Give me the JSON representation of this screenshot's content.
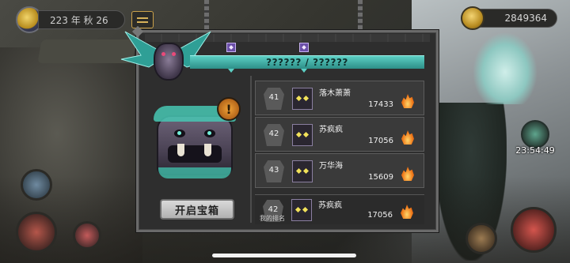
{
  "hud": {
    "date_text": "223 年 秋 26",
    "gold_amount": "2849364",
    "timer": "23:54:49"
  },
  "dialog": {
    "title": "?????? / ??????",
    "open_chest_label": "开启宝箱",
    "alert_glyph": "!",
    "my_rank_label": "我的排名"
  },
  "ranking": {
    "rows": [
      {
        "rank": "41",
        "name": "落木萧萧",
        "score": "17433"
      },
      {
        "rank": "42",
        "name": "苏疯疯",
        "score": "17056"
      },
      {
        "rank": "43",
        "name": "万华海",
        "score": "15609"
      }
    ],
    "my_row": {
      "rank": "42",
      "name": "苏疯疯",
      "score": "17056"
    }
  },
  "icons": {
    "season": "moon-icon",
    "currency": "gold-coin-icon",
    "menu": "menu-icon",
    "score": "fire-icon"
  },
  "colors": {
    "accent_teal": "#5ccfc4",
    "gold": "#d7b25a",
    "alert_orange": "#f0a236"
  }
}
